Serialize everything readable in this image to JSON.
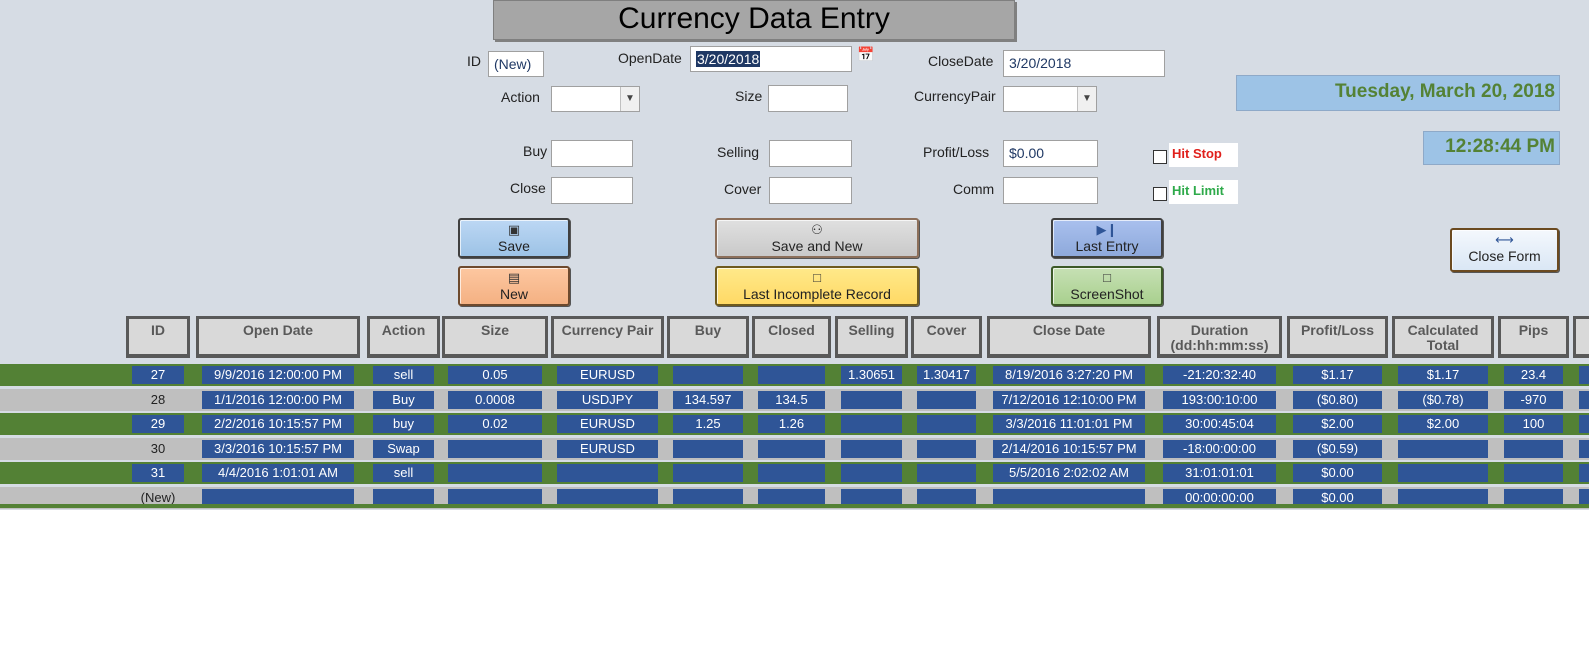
{
  "form": {
    "title": "Currency Data Entry",
    "id_label": "ID",
    "id_value": "(New)",
    "open_date_label": "OpenDate",
    "open_date_value": "3/20/2018",
    "close_date_label": "CloseDate",
    "close_date_value": "3/20/2018",
    "action_label": "Action",
    "size_label": "Size",
    "currency_pair_label": "CurrencyPair",
    "buy_label": "Buy",
    "selling_label": "Selling",
    "profit_loss_label": "Profit/Loss",
    "profit_loss_value": "$0.00",
    "close_label": "Close",
    "cover_label": "Cover",
    "comm_label": "Comm",
    "hit_stop_label": "Hit Stop",
    "hit_limit_label": "Hit Limit",
    "date_display": "Tuesday, March 20, 2018",
    "time_display": "12:28:44 PM"
  },
  "buttons": {
    "save": "Save",
    "save_and_new": "Save and New",
    "last_entry": "Last Entry",
    "new": "New",
    "last_incomplete": "Last Incomplete Record",
    "screenshot": "ScreenShot",
    "close_form": "Close Form"
  },
  "icons": {
    "save": "floppy-disk-icon",
    "save_and_new": "binoculars-icon",
    "last_entry": "last-record-icon",
    "new": "new-record-icon",
    "last_incomplete": "document-icon",
    "screenshot": "document-icon",
    "close_form": "exit-door-icon",
    "calendar": "calendar-icon"
  },
  "colors": {
    "form_background": "#d6dce4",
    "banner": "#9dc3e6",
    "banner_text": "#548235",
    "hit_stop": "#e0201b",
    "hit_limit": "#2eaa4a",
    "grid_cell": "#2f5597",
    "grid_row_green": "#538135",
    "grid_row_gray": "#bfbfbf"
  },
  "grid": {
    "columns": [
      {
        "key": "id",
        "label": "ID"
      },
      {
        "key": "open_date",
        "label": "Open Date"
      },
      {
        "key": "action",
        "label": "Action"
      },
      {
        "key": "size",
        "label": "Size"
      },
      {
        "key": "currency_pair",
        "label": "Currency Pair"
      },
      {
        "key": "buy",
        "label": "Buy"
      },
      {
        "key": "closed",
        "label": "Closed"
      },
      {
        "key": "selling",
        "label": "Selling"
      },
      {
        "key": "cover",
        "label": "Cover"
      },
      {
        "key": "close_date",
        "label": "Close Date"
      },
      {
        "key": "duration",
        "label": "Duration (dd:hh:mm:ss)"
      },
      {
        "key": "profit_loss",
        "label": "Profit/Loss"
      },
      {
        "key": "calculated_total",
        "label": "Calculated Total"
      },
      {
        "key": "pips",
        "label": "Pips"
      }
    ],
    "rows": [
      {
        "id": "27",
        "open_date": "9/9/2016 12:00:00 PM",
        "action": "sell",
        "size": "0.05",
        "currency_pair": "EURUSD",
        "buy": "",
        "closed": "",
        "selling": "1.30651",
        "cover": "1.30417",
        "close_date": "8/19/2016 3:27:20 PM",
        "duration": "-21:20:32:40",
        "profit_loss": "$1.17",
        "calculated_total": "$1.17",
        "pips": "23.4"
      },
      {
        "id": "28",
        "open_date": "1/1/2016 12:00:00 PM",
        "action": "Buy",
        "size": "0.0008",
        "currency_pair": "USDJPY",
        "buy": "134.597",
        "closed": "134.5",
        "selling": "",
        "cover": "",
        "close_date": "7/12/2016 12:10:00 PM",
        "duration": "193:00:10:00",
        "profit_loss": "($0.80)",
        "calculated_total": "($0.78)",
        "pips": "-970"
      },
      {
        "id": "29",
        "open_date": "2/2/2016 10:15:57 PM",
        "action": "buy",
        "size": "0.02",
        "currency_pair": "EURUSD",
        "buy": "1.25",
        "closed": "1.26",
        "selling": "",
        "cover": "",
        "close_date": "3/3/2016 11:01:01 PM",
        "duration": "30:00:45:04",
        "profit_loss": "$2.00",
        "calculated_total": "$2.00",
        "pips": "100"
      },
      {
        "id": "30",
        "open_date": "3/3/2016 10:15:57 PM",
        "action": "Swap",
        "size": "",
        "currency_pair": "EURUSD",
        "buy": "",
        "closed": "",
        "selling": "",
        "cover": "",
        "close_date": "2/14/2016 10:15:57 PM",
        "duration": "-18:00:00:00",
        "profit_loss": "($0.59)",
        "calculated_total": "",
        "pips": ""
      },
      {
        "id": "31",
        "open_date": "4/4/2016 1:01:01 AM",
        "action": "sell",
        "size": "",
        "currency_pair": "",
        "buy": "",
        "closed": "",
        "selling": "",
        "cover": "",
        "close_date": "5/5/2016 2:02:02 AM",
        "duration": "31:01:01:01",
        "profit_loss": "$0.00",
        "calculated_total": "",
        "pips": ""
      },
      {
        "id": "(New)",
        "open_date": "",
        "action": "",
        "size": "",
        "currency_pair": "",
        "buy": "",
        "closed": "",
        "selling": "",
        "cover": "",
        "close_date": "",
        "duration": "00:00:00:00",
        "profit_loss": "$0.00",
        "calculated_total": "",
        "pips": ""
      }
    ]
  }
}
